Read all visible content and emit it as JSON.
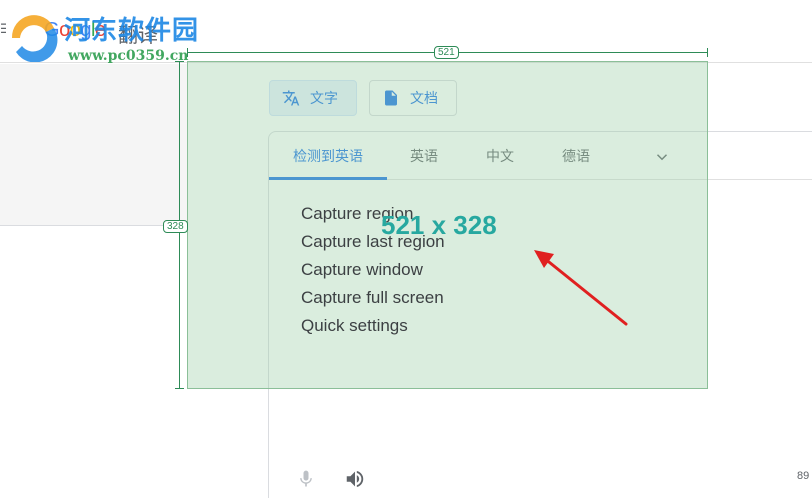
{
  "header": {
    "logo_letters": [
      "G",
      "o",
      "o",
      "g",
      "l",
      "e"
    ],
    "app_name": "翻译"
  },
  "mode_buttons": [
    {
      "label": "文字",
      "icon": "translate-icon",
      "active": true
    },
    {
      "label": "文档",
      "icon": "document-icon",
      "active": false
    }
  ],
  "language_tabs": [
    {
      "label": "检测到英语",
      "active": true
    },
    {
      "label": "英语",
      "active": false
    },
    {
      "label": "中文",
      "active": false
    },
    {
      "label": "德语",
      "active": false
    }
  ],
  "char_count": "89",
  "capture": {
    "width_label": "521",
    "height_label": "328",
    "size_readout": "521 x 328",
    "menu_items": [
      "Capture region",
      "Capture last region",
      "Capture window",
      "Capture full screen",
      "Quick settings"
    ]
  },
  "watermark": {
    "title": "河东软件园",
    "url": "www.pc0359.cn"
  },
  "colors": {
    "accent": "#1a73e8",
    "selection_fill": "#9dcfa8",
    "readout": "#27a8a0",
    "arrow": "#e02020"
  }
}
